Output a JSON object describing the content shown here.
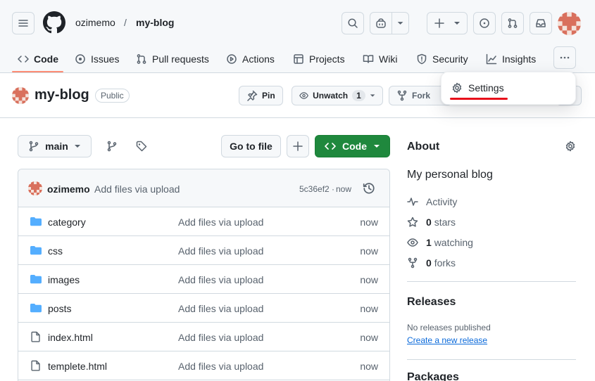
{
  "breadcrumb": {
    "owner": "ozimemo",
    "separator": "/",
    "repo": "my-blog"
  },
  "nav_tabs": [
    {
      "label": "Code",
      "icon": "code-icon",
      "active": true
    },
    {
      "label": "Issues",
      "icon": "issue-icon"
    },
    {
      "label": "Pull requests",
      "icon": "pull-request-icon"
    },
    {
      "label": "Actions",
      "icon": "play-icon"
    },
    {
      "label": "Projects",
      "icon": "table-icon"
    },
    {
      "label": "Wiki",
      "icon": "book-icon"
    },
    {
      "label": "Security",
      "icon": "shield-icon"
    },
    {
      "label": "Insights",
      "icon": "graph-icon"
    }
  ],
  "repo": {
    "name": "my-blog",
    "visibility": "Public",
    "pin_label": "Pin",
    "unwatch_label": "Unwatch",
    "watch_count": "1",
    "fork_label": "Fork"
  },
  "dropdown": {
    "settings_label": "Settings",
    "highlight_color": "#e8111b"
  },
  "toolbar": {
    "branch": "main",
    "go_to_file": "Go to file",
    "code_label": "Code",
    "code_color": "#1f883d"
  },
  "commit": {
    "author": "ozimemo",
    "message": "Add files via upload",
    "hash": "5c36ef2",
    "separator": "·",
    "time": "now"
  },
  "files": [
    {
      "name": "category",
      "type": "folder",
      "message": "Add files via upload",
      "age": "now"
    },
    {
      "name": "css",
      "type": "folder",
      "message": "Add files via upload",
      "age": "now"
    },
    {
      "name": "images",
      "type": "folder",
      "message": "Add files via upload",
      "age": "now"
    },
    {
      "name": "posts",
      "type": "folder",
      "message": "Add files via upload",
      "age": "now"
    },
    {
      "name": "index.html",
      "type": "file",
      "message": "Add files via upload",
      "age": "now"
    },
    {
      "name": "templete.html",
      "type": "file",
      "message": "Add files via upload",
      "age": "now"
    }
  ],
  "about": {
    "heading": "About",
    "description": "My personal blog",
    "activity": "Activity",
    "stars_count": "0",
    "stars_label": "stars",
    "watching_count": "1",
    "watching_label": "watching",
    "forks_count": "0",
    "forks_label": "forks"
  },
  "releases": {
    "heading": "Releases",
    "none_text": "No releases published",
    "create_link": "Create a new release"
  },
  "packages": {
    "heading": "Packages"
  },
  "colors": {
    "accent_tab": "#fd8c73",
    "folder": "#54aeff",
    "link": "#0969da"
  }
}
